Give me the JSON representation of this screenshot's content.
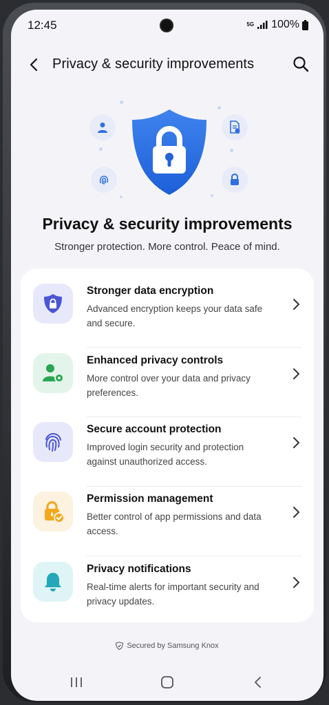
{
  "status_bar": {
    "time": "12:45",
    "network": "5G",
    "battery": "100%"
  },
  "header": {
    "title": "Privacy & security improvements"
  },
  "hero": {
    "title": "Privacy & security improvements",
    "subtitle": "Stronger protection. More control. Peace of mind."
  },
  "features": [
    {
      "title": "Stronger data encryption",
      "desc": "Advanced encryption keeps your data safe and secure.",
      "icon": "shield-lock-icon",
      "tile_color": "#e7e9fb",
      "icon_color": "#4b55d6"
    },
    {
      "title": "Enhanced privacy controls",
      "desc": "More control over your data and privacy preferences.",
      "icon": "user-settings-icon",
      "tile_color": "#e3f5ea",
      "icon_color": "#2aa651"
    },
    {
      "title": "Secure account protection",
      "desc": "Improved login security and protection against unauthorized access.",
      "icon": "fingerprint-icon",
      "tile_color": "#e7e9fb",
      "icon_color": "#4b55d6"
    },
    {
      "title": "Permission management",
      "desc": "Better control of app permissions and data access.",
      "icon": "lock-check-icon",
      "tile_color": "#fdf1df",
      "icon_color": "#f2a81d"
    },
    {
      "title": "Privacy notifications",
      "desc": "Real-time alerts for important security and privacy updates.",
      "icon": "bell-icon",
      "tile_color": "#dff4f6",
      "icon_color": "#23a8b9"
    }
  ],
  "footer": {
    "knox_text": "Secured by Samsung Knox"
  },
  "colors": {
    "accent": "#2f6fe0",
    "background": "#f4f4f8"
  }
}
